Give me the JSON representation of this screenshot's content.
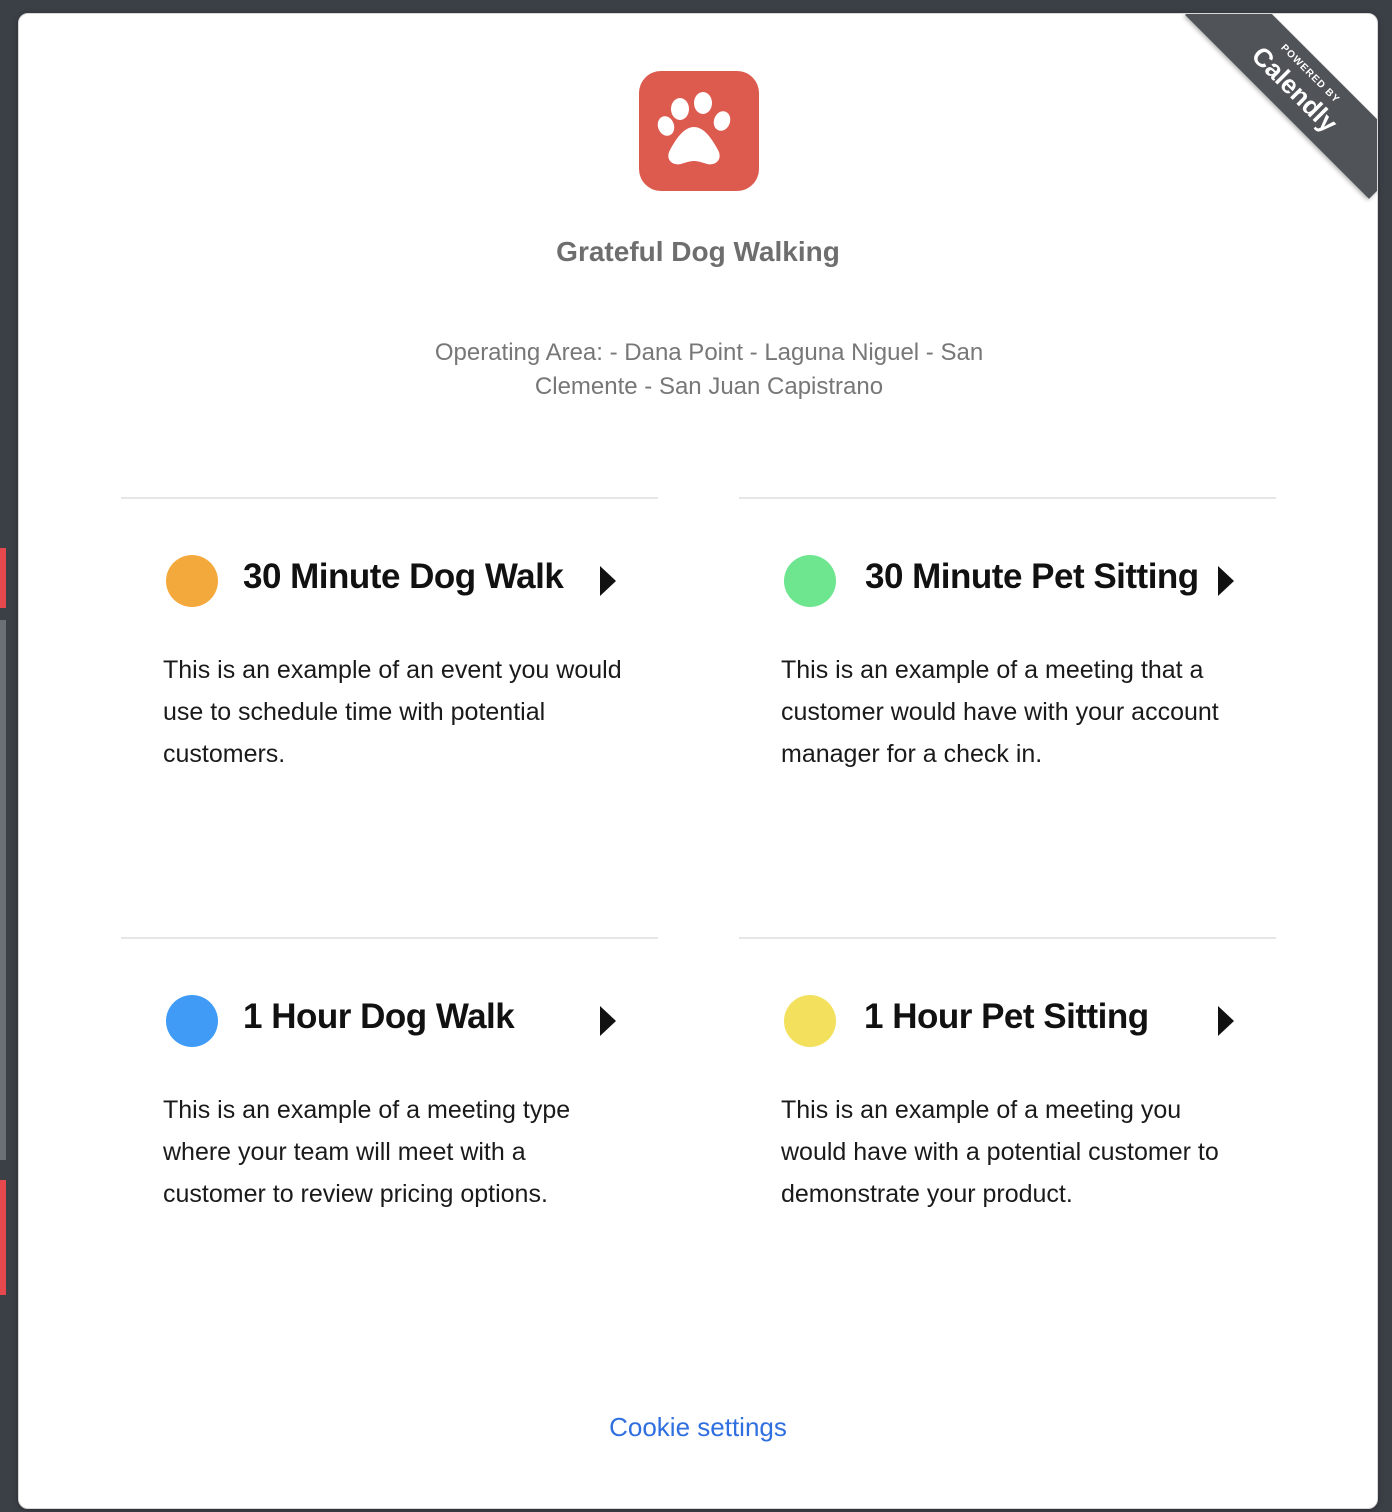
{
  "ribbon": {
    "powered_by": "POWERED BY",
    "brand": "Calendly",
    "color": "#505357"
  },
  "organization": {
    "logo_icon": "paw-icon",
    "logo_color": "#dd5a4f",
    "name": "Grateful Dog Walking",
    "description": "Operating Area: - Dana Point - Laguna Niguel - San Clemente - San Juan Capistrano"
  },
  "events": [
    {
      "title": "30 Minute Dog Walk",
      "color": "#f3a93c",
      "description": "This is an example of an event you would use to schedule time with potential customers."
    },
    {
      "title": "30 Minute Pet Sitting",
      "color": "#6ee58f",
      "description": "This is an example of a meeting that a customer would have with your account manager for a check in."
    },
    {
      "title": "1 Hour Dog Walk",
      "color": "#3f9bf6",
      "description": "This is an example of a meeting type where your team will meet with a customer to review pricing options."
    },
    {
      "title": "1 Hour Pet Sitting",
      "color": "#f3e15e",
      "description": "This is an example of a meeting you would have with a potential customer to demonstrate your product."
    }
  ],
  "footer": {
    "cookie_settings": "Cookie settings"
  }
}
